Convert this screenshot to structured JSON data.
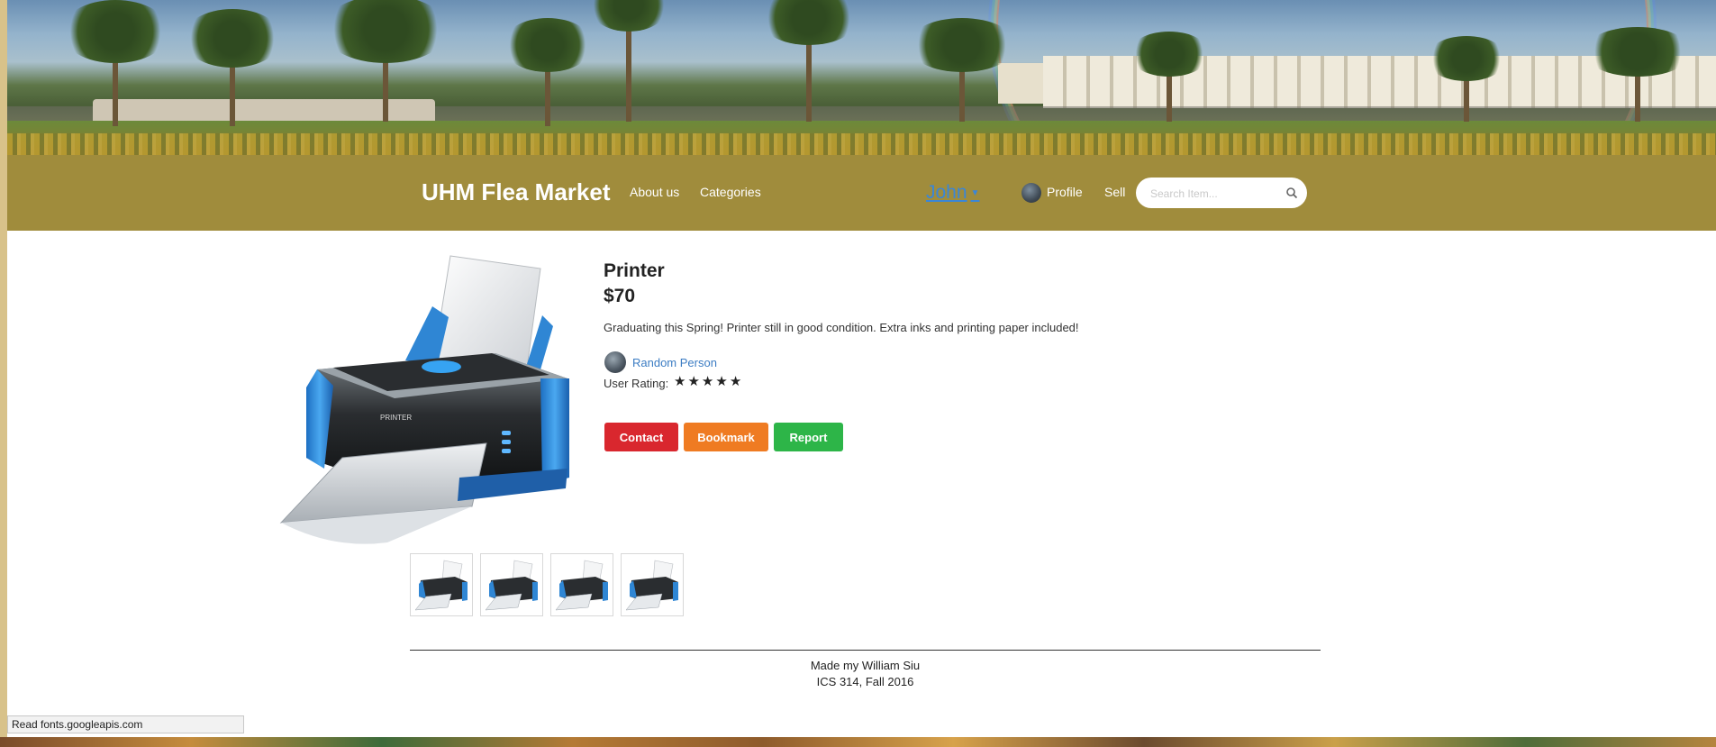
{
  "navbar": {
    "brand": "UHM Flea Market",
    "links": [
      {
        "label": "About us"
      },
      {
        "label": "Categories"
      }
    ],
    "user_menu": {
      "label": "John"
    },
    "profile_label": "Profile",
    "sell_label": "Sell",
    "search": {
      "placeholder": "Search Item...",
      "value": ""
    }
  },
  "product": {
    "title": "Printer",
    "price": "$70",
    "description": "Graduating this Spring! Printer still in good condition. Extra inks and printing paper included!",
    "seller": "Random Person",
    "rating_label": "User Rating:",
    "rating": 5,
    "rating_max": 5,
    "thumbnail_count": 4
  },
  "actions": {
    "contact": "Contact",
    "bookmark": "Bookmark",
    "report": "Report"
  },
  "footer": {
    "line1": "Made my William Siu",
    "line2": "ICS 314, Fall 2016"
  },
  "status_bar": "Read fonts.googleapis.com",
  "colors": {
    "navbar": "#a08c3c",
    "contact": "#d9272e",
    "bookmark": "#ef7b22",
    "report": "#2db548",
    "link": "#3b7cc3"
  }
}
